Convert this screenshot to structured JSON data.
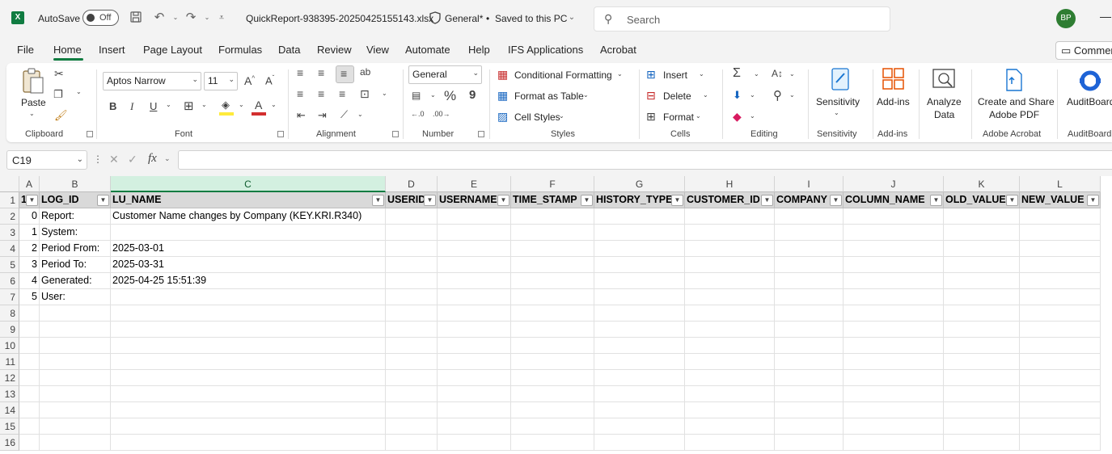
{
  "titlebar": {
    "app_icon": "X",
    "autosave_label": "AutoSave",
    "autosave_state": "Off",
    "filename": "QuickReport-938395-20250425155143.xlsx",
    "sensitivity": "General*",
    "save_status": "Saved to this PC",
    "search_placeholder": "Search",
    "user_initials": "BP",
    "minimize": "—"
  },
  "tabs": [
    "File",
    "Home",
    "Insert",
    "Page Layout",
    "Formulas",
    "Data",
    "Review",
    "View",
    "Automate",
    "Help",
    "IFS Applications",
    "Acrobat"
  ],
  "active_tab": "Home",
  "comments_label": "Comments",
  "ribbon": {
    "clipboard": {
      "label": "Clipboard",
      "paste": "Paste"
    },
    "font": {
      "label": "Font",
      "font_name": "Aptos Narrow",
      "font_size": "11",
      "bold": "B",
      "italic": "I",
      "underline": "U"
    },
    "alignment": {
      "label": "Alignment"
    },
    "number": {
      "label": "Number",
      "format": "General",
      "percent": "%",
      "comma": "9"
    },
    "styles": {
      "label": "Styles",
      "conditional": "Conditional Formatting",
      "format_table": "Format as Table",
      "cell_styles": "Cell Styles"
    },
    "cells": {
      "label": "Cells",
      "insert": "Insert",
      "delete": "Delete",
      "format": "Format"
    },
    "editing": {
      "label": "Editing"
    },
    "sensitivity": {
      "label": "Sensitivity",
      "button": "Sensitivity"
    },
    "addins": {
      "label": "Add-ins",
      "button": "Add-ins"
    },
    "analyze": {
      "button_line1": "Analyze",
      "button_line2": "Data"
    },
    "acrobat": {
      "label": "Adobe Acrobat",
      "button_line1": "Create and Share",
      "button_line2": "Adobe PDF"
    },
    "auditboard": {
      "label": "AuditBoard",
      "button": "AuditBoard"
    }
  },
  "formula_bar": {
    "name_box": "C19",
    "fx": "fx",
    "formula": ""
  },
  "grid": {
    "columns": [
      "A",
      "B",
      "C",
      "D",
      "E",
      "F",
      "G",
      "H",
      "I",
      "J",
      "K",
      "L"
    ],
    "selected_column": "C",
    "rows": [
      "1",
      "2",
      "3",
      "4",
      "5",
      "6",
      "7",
      "8",
      "9",
      "10",
      "11",
      "12",
      "13",
      "14",
      "15",
      "16"
    ],
    "headers": [
      "1",
      "LOG_ID",
      "LU_NAME",
      "USERID",
      "USERNAME",
      "TIME_STAMP",
      "HISTORY_TYPE",
      "CUSTOMER_ID",
      "COMPANY",
      "COLUMN_NAME",
      "OLD_VALUE",
      "NEW_VALUE"
    ],
    "data": [
      [
        "0",
        "Report:",
        "Customer Name changes by Company (KEY.KRI.R340)"
      ],
      [
        "1",
        "System:",
        ""
      ],
      [
        "2",
        "Period From:",
        "2025-03-01"
      ],
      [
        "3",
        "Period To:",
        "2025-03-31"
      ],
      [
        "4",
        "Generated:",
        "2025-04-25 15:51:39"
      ],
      [
        "5",
        "User:",
        ""
      ]
    ]
  }
}
